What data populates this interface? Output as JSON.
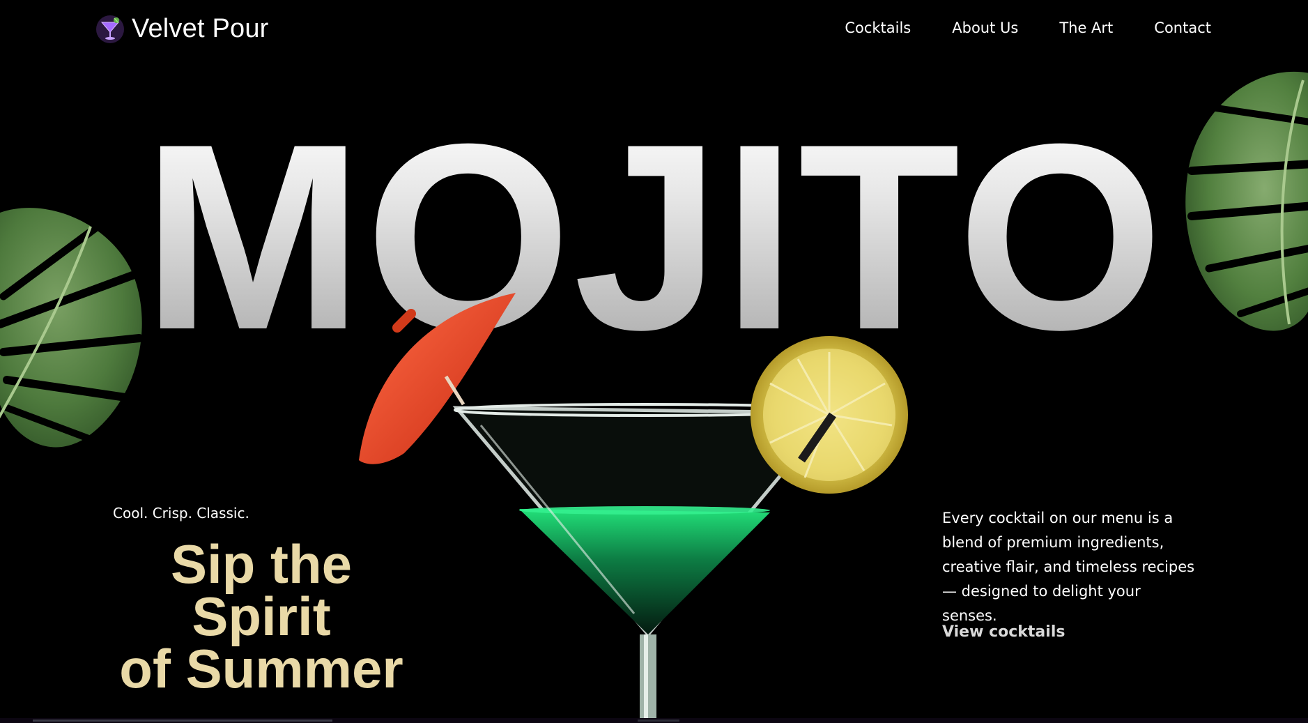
{
  "brand": {
    "name": "Velvet Pour",
    "logo_icon": "cocktail-glass-icon"
  },
  "nav": {
    "links": [
      "Cocktails",
      "About Us",
      "The Art",
      "Contact"
    ]
  },
  "hero": {
    "title": "MOJITO",
    "tagline": "Cool. Crisp. Classic.",
    "headline_line1": "Sip the Spirit",
    "headline_line2": "of Summer",
    "description": "Every cocktail on our menu is a blend of premium ingredients, creative flair, and timeless recipes — designed to delight your senses.",
    "cta": "View cocktails"
  },
  "colors": {
    "background": "#000000",
    "headline_gold": "#e9d9a7",
    "leaf_green": "#4f7a3e",
    "umbrella_red": "#e0321c",
    "lemon_yellow": "#e7d15a",
    "drink_green": "#17c86a"
  },
  "icons": [
    "cocktail-glass-icon",
    "monstera-leaf-left-icon",
    "monstera-leaf-right-icon",
    "martini-glass-illustration"
  ]
}
